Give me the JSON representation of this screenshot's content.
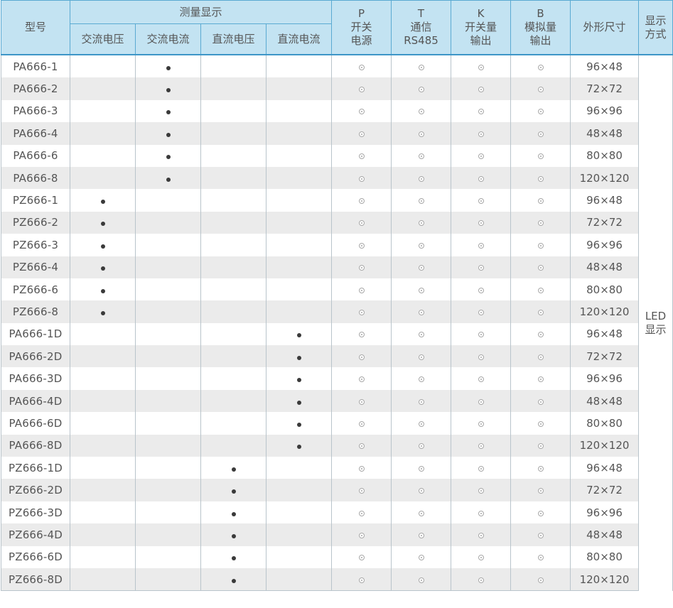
{
  "header": {
    "model": "型号",
    "measurement_group": "测量显示",
    "measure_cols": [
      "交流电压",
      "交流电流",
      "直流电压",
      "直流电流"
    ],
    "option_cols": [
      {
        "code": "P",
        "line1": "开关",
        "line2": "电源"
      },
      {
        "code": "T",
        "line1": "通信",
        "line2": "RS485"
      },
      {
        "code": "K",
        "line1": "开关量",
        "line2": "输出"
      },
      {
        "code": "B",
        "line1": "模拟量",
        "line2": "输出"
      }
    ],
    "dimensions": "外形尺寸",
    "display_line1": "显示",
    "display_line2": "方式"
  },
  "display_value": {
    "line1": "LED",
    "line2": "显示"
  },
  "rows": [
    {
      "model": "PA666-1",
      "measure": 1,
      "dim": "96×48"
    },
    {
      "model": "PA666-2",
      "measure": 1,
      "dim": "72×72"
    },
    {
      "model": "PA666-3",
      "measure": 1,
      "dim": "96×96"
    },
    {
      "model": "PA666-4",
      "measure": 1,
      "dim": "48×48"
    },
    {
      "model": "PA666-6",
      "measure": 1,
      "dim": "80×80"
    },
    {
      "model": "PA666-8",
      "measure": 1,
      "dim": "120×120"
    },
    {
      "model": "PZ666-1",
      "measure": 0,
      "dim": "96×48"
    },
    {
      "model": "PZ666-2",
      "measure": 0,
      "dim": "72×72"
    },
    {
      "model": "PZ666-3",
      "measure": 0,
      "dim": "96×96"
    },
    {
      "model": "PZ666-4",
      "measure": 0,
      "dim": "48×48"
    },
    {
      "model": "PZ666-6",
      "measure": 0,
      "dim": "80×80"
    },
    {
      "model": "PZ666-8",
      "measure": 0,
      "dim": "120×120"
    },
    {
      "model": "PA666-1D",
      "measure": 3,
      "dim": "96×48"
    },
    {
      "model": "PA666-2D",
      "measure": 3,
      "dim": "72×72"
    },
    {
      "model": "PA666-3D",
      "measure": 3,
      "dim": "96×96"
    },
    {
      "model": "PA666-4D",
      "measure": 3,
      "dim": "48×48"
    },
    {
      "model": "PA666-6D",
      "measure": 3,
      "dim": "80×80"
    },
    {
      "model": "PA666-8D",
      "measure": 3,
      "dim": "120×120"
    },
    {
      "model": "PZ666-1D",
      "measure": 2,
      "dim": "96×48"
    },
    {
      "model": "PZ666-2D",
      "measure": 2,
      "dim": "72×72"
    },
    {
      "model": "PZ666-3D",
      "measure": 2,
      "dim": "96×96"
    },
    {
      "model": "PZ666-4D",
      "measure": 2,
      "dim": "48×48"
    },
    {
      "model": "PZ666-6D",
      "measure": 2,
      "dim": "80×80"
    },
    {
      "model": "PZ666-8D",
      "measure": 2,
      "dim": "120×120"
    }
  ],
  "symbols": {
    "standard": "filled-dot",
    "optional": "ring-dot"
  },
  "colors": {
    "header_bg": "#c3e3f2",
    "header_border": "#5aaad2",
    "stripe": "#ebebeb"
  }
}
